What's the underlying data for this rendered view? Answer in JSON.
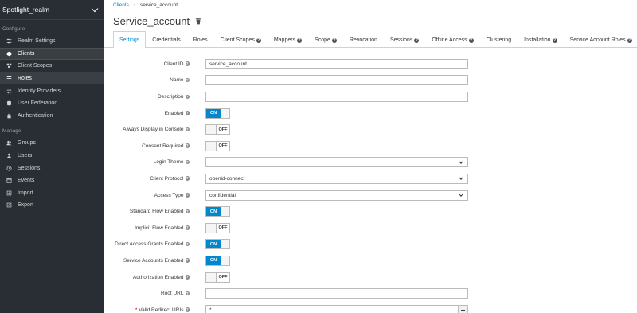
{
  "sidebar": {
    "realm_name": "Spotlight_realm",
    "configure_label": "Configure",
    "manage_label": "Manage",
    "configure_items": [
      {
        "label": "Realm Settings",
        "icon": "sliders-icon"
      },
      {
        "label": "Clients",
        "icon": "cube-icon"
      },
      {
        "label": "Client Scopes",
        "icon": "cubes-icon"
      },
      {
        "label": "Roles",
        "icon": "list-icon"
      },
      {
        "label": "Identity Providers",
        "icon": "exchange-icon"
      },
      {
        "label": "User Federation",
        "icon": "database-icon"
      },
      {
        "label": "Authentication",
        "icon": "lock-icon"
      }
    ],
    "manage_items": [
      {
        "label": "Groups",
        "icon": "users-icon"
      },
      {
        "label": "Users",
        "icon": "user-icon"
      },
      {
        "label": "Sessions",
        "icon": "clock-icon"
      },
      {
        "label": "Events",
        "icon": "calendar-icon"
      },
      {
        "label": "Import",
        "icon": "import-icon"
      },
      {
        "label": "Export",
        "icon": "export-icon"
      }
    ],
    "active_item": "Clients",
    "highlighted_item": "Roles"
  },
  "breadcrumb": {
    "root": "Clients",
    "separator": "›",
    "current": "service_account"
  },
  "page": {
    "title": "Service_account"
  },
  "tabs": [
    {
      "label": "Settings",
      "help": false
    },
    {
      "label": "Credentials",
      "help": false
    },
    {
      "label": "Roles",
      "help": false
    },
    {
      "label": "Client Scopes",
      "help": true
    },
    {
      "label": "Mappers",
      "help": true
    },
    {
      "label": "Scope",
      "help": true
    },
    {
      "label": "Revocation",
      "help": false
    },
    {
      "label": "Sessions",
      "help": true
    },
    {
      "label": "Offline Access",
      "help": true
    },
    {
      "label": "Clustering",
      "help": false
    },
    {
      "label": "Installation",
      "help": true
    },
    {
      "label": "Service Account Roles",
      "help": true
    }
  ],
  "form": {
    "client_id": {
      "label": "Client ID",
      "value": "service_account"
    },
    "name": {
      "label": "Name",
      "value": ""
    },
    "description": {
      "label": "Description",
      "value": ""
    },
    "enabled": {
      "label": "Enabled",
      "state": "ON"
    },
    "always_display": {
      "label": "Always Display in Console",
      "state": "OFF"
    },
    "consent_required": {
      "label": "Consent Required",
      "state": "OFF"
    },
    "login_theme": {
      "label": "Login Theme",
      "value": ""
    },
    "client_protocol": {
      "label": "Client Protocol",
      "value": "openid-connect"
    },
    "access_type": {
      "label": "Access Type",
      "value": "confidential"
    },
    "standard_flow": {
      "label": "Standard Flow Enabled",
      "state": "ON"
    },
    "implicit_flow": {
      "label": "Implicit Flow Enabled",
      "state": "OFF"
    },
    "direct_access": {
      "label": "Direct Access Grants Enabled",
      "state": "ON"
    },
    "service_accounts": {
      "label": "Service Accounts Enabled",
      "state": "ON"
    },
    "authorization": {
      "label": "Authorization Enabled",
      "state": "OFF"
    },
    "root_url": {
      "label": "Root URL",
      "value": ""
    },
    "redirect_uris": {
      "label": "Valid Redirect URIs",
      "required_mark": "*",
      "value": "*"
    }
  },
  "colors": {
    "sidebar_bg": "#292e34",
    "accent": "#0088ce"
  }
}
